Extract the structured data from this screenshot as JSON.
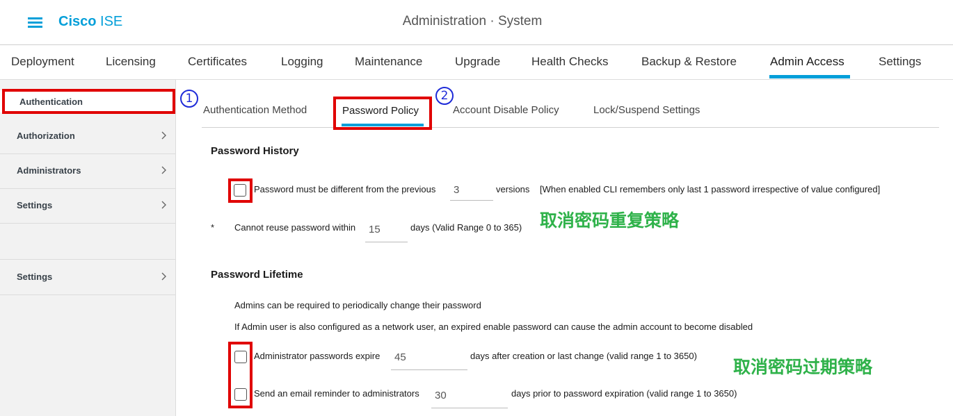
{
  "header": {
    "brand_bold": "Cisco",
    "brand_light": "ISE",
    "title": "Administration · System"
  },
  "topnav": [
    "Deployment",
    "Licensing",
    "Certificates",
    "Logging",
    "Maintenance",
    "Upgrade",
    "Health Checks",
    "Backup & Restore",
    "Admin Access",
    "Settings"
  ],
  "sidebar": {
    "items": [
      "Authentication",
      "Authorization",
      "Administrators",
      "Settings",
      "Settings"
    ]
  },
  "annotations": {
    "step1": "1",
    "step2": "2",
    "note_history": "取消密码重复策略",
    "note_lifetime": "取消密码过期策略"
  },
  "subtabs": [
    "Authentication Method",
    "Password Policy",
    "Account Disable Policy",
    "Lock/Suspend Settings"
  ],
  "history": {
    "heading": "Password History",
    "row1_label": "Password must be different from the previous",
    "row1_value": "3",
    "row1_suffix": "versions",
    "row1_note": "[When enabled CLI remembers only last 1 password irrespective of value configured]",
    "row2_star": "*",
    "row2_label": "Cannot reuse password within",
    "row2_value": "15",
    "row2_suffix": "days (Valid Range 0 to 365)"
  },
  "lifetime": {
    "heading": "Password Lifetime",
    "desc1": "Admins can be required to periodically change their password",
    "desc2": "If Admin user is also configured as a network user, an expired enable password can cause the admin account to become disabled",
    "expire_label": "Administrator passwords expire",
    "expire_value": "45",
    "expire_suffix": "days after creation or last change (valid range 1 to 3650)",
    "reminder_label": "Send an email reminder to administrators",
    "reminder_value": "30",
    "reminder_suffix": "days prior to password expiration (valid range 1 to 3650)"
  }
}
